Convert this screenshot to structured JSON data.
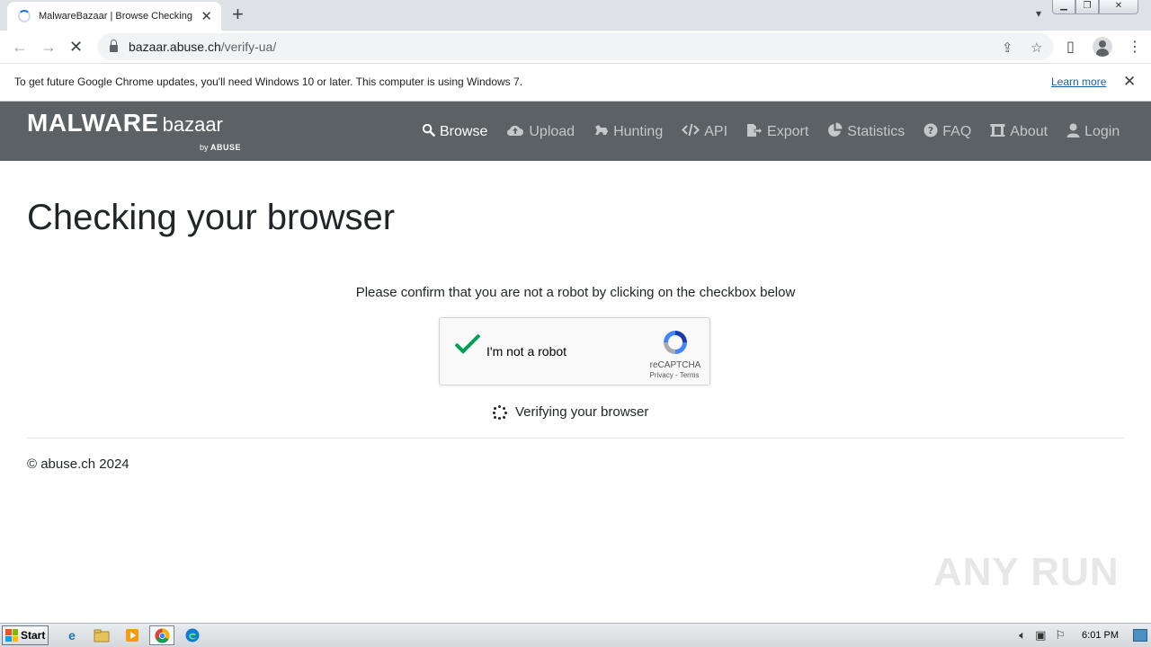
{
  "browser": {
    "tab_title": "MalwareBazaar | Browse Checking y",
    "url_host": "bazaar.abuse.ch",
    "url_path": "/verify-ua/"
  },
  "infobar": {
    "message": "To get future Google Chrome updates, you'll need Windows 10 or later. This computer is using Windows 7.",
    "link": "Learn more"
  },
  "site": {
    "logo_main": "MALWARE",
    "logo_sub": "bazaar",
    "logo_by": "by",
    "logo_brand": "ABUSE",
    "nav": [
      {
        "label": "Browse",
        "icon": "search-icon"
      },
      {
        "label": "Upload",
        "icon": "cloud-upload-icon"
      },
      {
        "label": "Hunting",
        "icon": "hunting-icon"
      },
      {
        "label": "API",
        "icon": "code-icon"
      },
      {
        "label": "Export",
        "icon": "export-icon"
      },
      {
        "label": "Statistics",
        "icon": "pie-chart-icon"
      },
      {
        "label": "FAQ",
        "icon": "question-icon"
      },
      {
        "label": "About",
        "icon": "bank-icon"
      },
      {
        "label": "Login",
        "icon": "user-icon"
      }
    ]
  },
  "content": {
    "title": "Checking your browser",
    "instruction": "Please confirm that you are not a robot by clicking on the checkbox below",
    "captcha_label": "I'm not a robot",
    "recaptcha_brand": "reCAPTCHA",
    "recaptcha_links": "Privacy - Terms",
    "status": "Verifying your browser",
    "copyright": "© abuse.ch 2024"
  },
  "watermark": "ANY RUN",
  "taskbar": {
    "start": "Start",
    "time": "6:01 PM"
  },
  "colors": {
    "navbar": "#5b6164",
    "check": "#009f56",
    "link": "#1a5fb4"
  }
}
